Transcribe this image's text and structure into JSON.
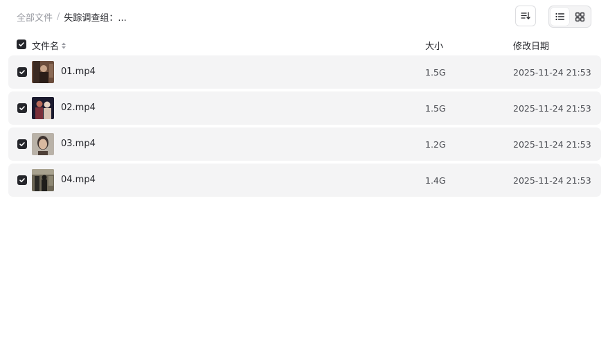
{
  "breadcrumb": {
    "root": "全部文件",
    "separator": "/",
    "current": "失踪调查组：..."
  },
  "toolbar": {
    "sort_icon": "sort-list-icon",
    "views": [
      {
        "icon": "list-view-icon",
        "active": true
      },
      {
        "icon": "grid-view-icon",
        "active": false
      }
    ]
  },
  "header": {
    "name": "文件名",
    "size": "大小",
    "date": "修改日期",
    "all_checked": true
  },
  "files": [
    {
      "name": "01.mp4",
      "size": "1.5G",
      "date": "2025-11-24 21:53",
      "checked": true,
      "thumb_colors": [
        "#6b4d3c",
        "#c9a58a",
        "#2a1d18"
      ]
    },
    {
      "name": "02.mp4",
      "size": "1.5G",
      "date": "2025-11-24 21:53",
      "checked": true,
      "thumb_colors": [
        "#1b1a2e",
        "#b86a5a",
        "#e7d3c4"
      ]
    },
    {
      "name": "03.mp4",
      "size": "1.2G",
      "date": "2025-11-24 21:53",
      "checked": true,
      "thumb_colors": [
        "#b9b2a8",
        "#d9b9a0",
        "#3e3330"
      ]
    },
    {
      "name": "04.mp4",
      "size": "1.4G",
      "date": "2025-11-24 21:53",
      "checked": true,
      "thumb_colors": [
        "#6d6757",
        "#2b2a26",
        "#a8a28f"
      ]
    }
  ]
}
